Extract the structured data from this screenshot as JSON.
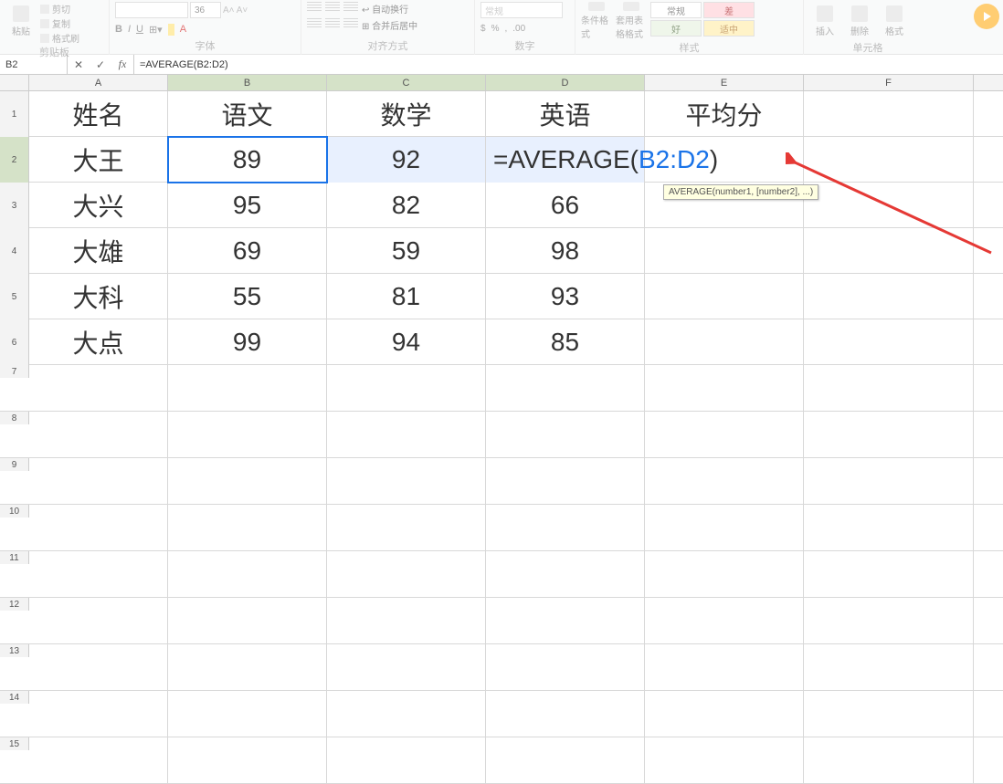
{
  "ribbon": {
    "clipboard": {
      "label": "剪贴板",
      "paste": "粘贴",
      "cut": "剪切",
      "copy": "复制",
      "format_painter": "格式刷"
    },
    "font": {
      "label": "字体",
      "size": "36",
      "bold": "B",
      "italic": "I",
      "underline": "U"
    },
    "alignment": {
      "label": "对齐方式",
      "wrap": "自动换行",
      "merge": "合并后居中"
    },
    "number": {
      "label": "数字",
      "format": "常规"
    },
    "styles": {
      "label": "样式",
      "cond": "条件格式",
      "table": "套用表格格式",
      "normal": "常规",
      "bad": "差",
      "good": "好",
      "neutral": "适中"
    },
    "cells": {
      "label": "单元格",
      "insert": "插入",
      "delete": "删除",
      "format": "格式"
    }
  },
  "formula_bar": {
    "name_box": "B2",
    "formula": "=AVERAGE(B2:D2)"
  },
  "columns": [
    "A",
    "B",
    "C",
    "D",
    "E",
    "F"
  ],
  "headers": [
    "姓名",
    "语文",
    "数学",
    "英语",
    "平均分"
  ],
  "rows": [
    {
      "name": "大王",
      "yuwen": "89",
      "shuxue": "92",
      "yingyu": "",
      "pingjun": ""
    },
    {
      "name": "大兴",
      "yuwen": "95",
      "shuxue": "82",
      "yingyu": "66",
      "pingjun": ""
    },
    {
      "name": "大雄",
      "yuwen": "69",
      "shuxue": "59",
      "yingyu": "98",
      "pingjun": ""
    },
    {
      "name": "大科",
      "yuwen": "55",
      "shuxue": "81",
      "yingyu": "93",
      "pingjun": ""
    },
    {
      "name": "大点",
      "yuwen": "99",
      "shuxue": "94",
      "yingyu": "85",
      "pingjun": ""
    }
  ],
  "editing": {
    "display_prefix": "=AVERAGE(",
    "display_ref": "B2:D2",
    "display_suffix": ")",
    "tooltip": "AVERAGE(number1, [number2], ...)"
  },
  "row_numbers": [
    "1",
    "2",
    "3",
    "4",
    "5",
    "6",
    "7",
    "8",
    "9",
    "10",
    "11",
    "12",
    "13",
    "14",
    "15"
  ]
}
